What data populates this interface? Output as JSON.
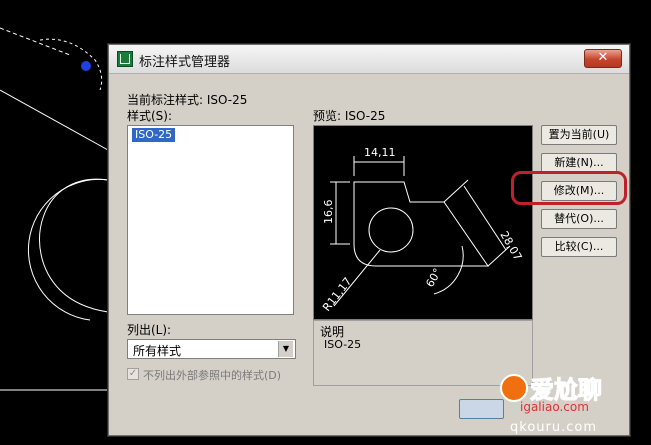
{
  "dialog": {
    "title": "标注样式管理器",
    "current_style_label": "当前标注样式: ISO-25",
    "styles_label": "样式(S):",
    "styles": [
      "ISO-25"
    ],
    "preview_label": "预览: ISO-25",
    "description_label": "说明",
    "description_value": "ISO-25",
    "list_label": "列出(L):",
    "list_value": "所有样式",
    "checkbox_label": "不列出外部参照中的样式(D)",
    "checkbox_checked": true,
    "buttons": {
      "set_current": "置为当前(U)",
      "new": "新建(N)...",
      "modify": "修改(M)...",
      "override": "替代(O)...",
      "compare": "比较(C)..."
    }
  },
  "preview_dims": {
    "top": "14,11",
    "left": "16,6",
    "right": "28,07",
    "angle": "60°",
    "radius": "R11,17"
  },
  "watermark": {
    "line1": "爱尬聊",
    "line2": "igaliao.com",
    "line3": "qkouru.com"
  },
  "colors": {
    "highlight_ring": "#c0202a",
    "selection": "#3168c6",
    "dialog_bg": "#d4d0c8"
  }
}
